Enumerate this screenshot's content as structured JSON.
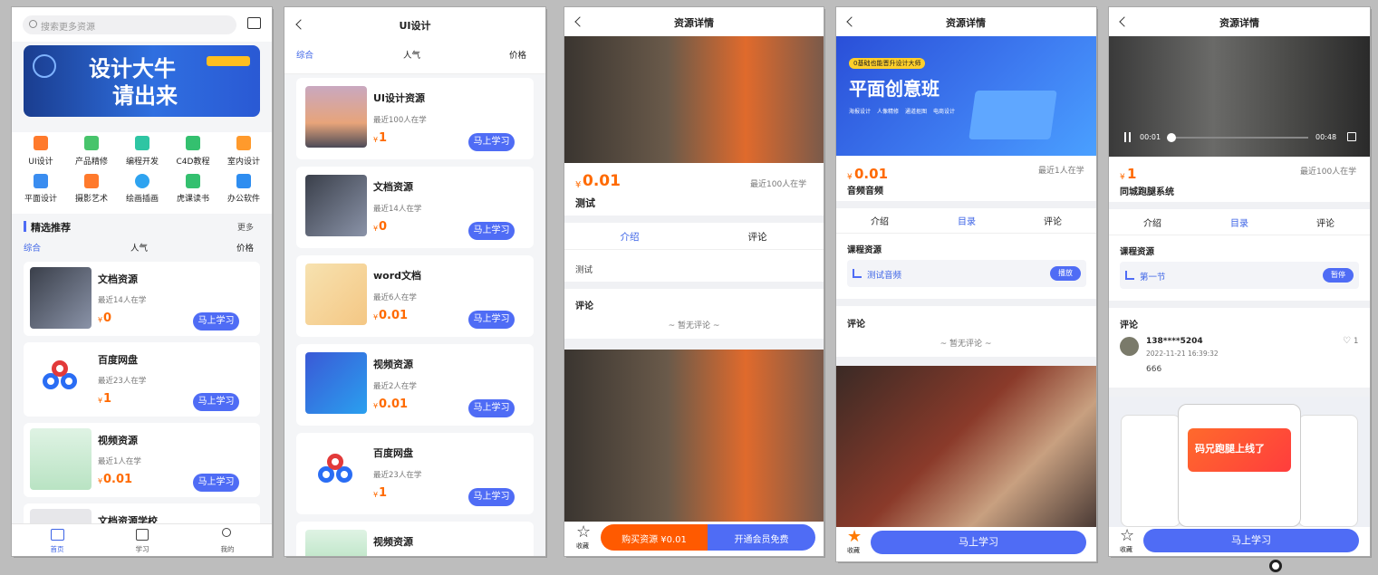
{
  "screen1": {
    "search_placeholder": "搜索更多资源",
    "banner_title_1": "设计大牛",
    "banner_title_2": "请出来",
    "categories": [
      "UI设计",
      "产品精修",
      "编程开发",
      "C4D教程",
      "室内设计",
      "平面设计",
      "摄影艺术",
      "绘画插画",
      "虎课读书",
      "办公软件"
    ],
    "section_title": "精选推荐",
    "section_more": "更多",
    "filter": {
      "overall": "综合",
      "popular": "人气",
      "price": "价格"
    },
    "items": [
      {
        "title": "文档资源",
        "learners": "最近14人在学",
        "price": "0",
        "button": "马上学习"
      },
      {
        "title": "百度网盘",
        "learners": "最近23人在学",
        "price": "1",
        "button": "马上学习"
      },
      {
        "title": "视频资源",
        "learners": "最近1人在学",
        "price": "0.01",
        "button": "马上学习"
      },
      {
        "title": "文档资源学校"
      }
    ],
    "tabs": [
      "首页",
      "学习",
      "我的"
    ],
    "currency": "¥"
  },
  "screen2": {
    "title": "UI设计",
    "filter": {
      "overall": "综合",
      "popular": "人气",
      "price": "价格"
    },
    "items": [
      {
        "title": "UI设计资源",
        "learners": "最近100人在学",
        "price": "1",
        "button": "马上学习"
      },
      {
        "title": "文档资源",
        "learners": "最近14人在学",
        "price": "0",
        "button": "马上学习"
      },
      {
        "title": "word文档",
        "learners": "最近6人在学",
        "price": "0.01",
        "button": "马上学习"
      },
      {
        "title": "视频资源",
        "learners": "最近2人在学",
        "price": "0.01",
        "button": "马上学习"
      },
      {
        "title": "百度网盘",
        "learners": "最近23人在学",
        "price": "1",
        "button": "马上学习"
      },
      {
        "title": "视频资源"
      }
    ]
  },
  "screen3": {
    "title": "资源详情",
    "price": "0.01",
    "learners": "最近100人在学",
    "name": "测试",
    "tabs": [
      "介绍",
      "评论"
    ],
    "intro": "测试",
    "comment_title": "评论",
    "no_comment": "~ 暂无评论 ~",
    "fav": "收藏",
    "buy": "购买资源 ¥0.01",
    "vip": "开通会员免费"
  },
  "screen4": {
    "title": "资源详情",
    "banner_tag": "0基础也能晋升设计大师",
    "banner_title": "平面创意班",
    "banner_features": [
      "海报设计",
      "人像精修",
      "通道抠图",
      "电商设计"
    ],
    "price": "0.01",
    "learners": "最近1人在学",
    "name": "音频音频",
    "tabs": [
      "介绍",
      "目录",
      "评论"
    ],
    "section": "课程资源",
    "resource": "测试音频",
    "play": "播放",
    "comment_title": "评论",
    "no_comment": "~ 暂无评论 ~",
    "fav": "收藏",
    "learn": "马上学习"
  },
  "screen5": {
    "title": "资源详情",
    "time_current": "00:01",
    "time_total": "00:48",
    "price": "1",
    "learners": "最近100人在学",
    "name": "同城跑腿系统",
    "tabs": [
      "介绍",
      "目录",
      "评论"
    ],
    "section": "课程资源",
    "resource": "第一节",
    "pause": "暂停",
    "comment_title": "评论",
    "comment": {
      "user": "138****5204",
      "time": "2022-11-21 16:39:32",
      "text": "666",
      "likes": "1"
    },
    "promo": "码兄跑腿上线了",
    "fav": "收藏",
    "learn": "马上学习"
  },
  "colors": {
    "accent": "#4f6cf5",
    "price": "#ff6a00",
    "buy": "#ff5a00"
  }
}
